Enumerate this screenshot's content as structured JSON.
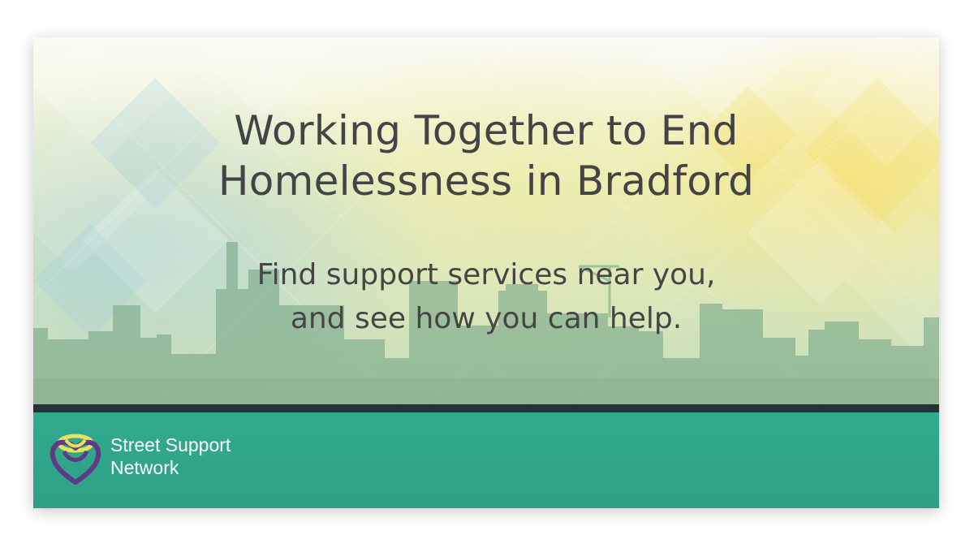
{
  "headline": {
    "line1": "Working Together to End",
    "line2": "Homelessness in Bradford"
  },
  "subheadline": {
    "line1": "Find support services near you,",
    "line2": "and see how you can help."
  },
  "brand": {
    "line1": "Street Support",
    "line2": "Network",
    "logo": "heart-knot-icon"
  },
  "colors": {
    "footer": "#32ab8d",
    "divider": "#263238",
    "text": "#444444",
    "skyline": "#7aa989",
    "logo_purple": "#5e3b86",
    "logo_yellow": "#e9e25a"
  }
}
